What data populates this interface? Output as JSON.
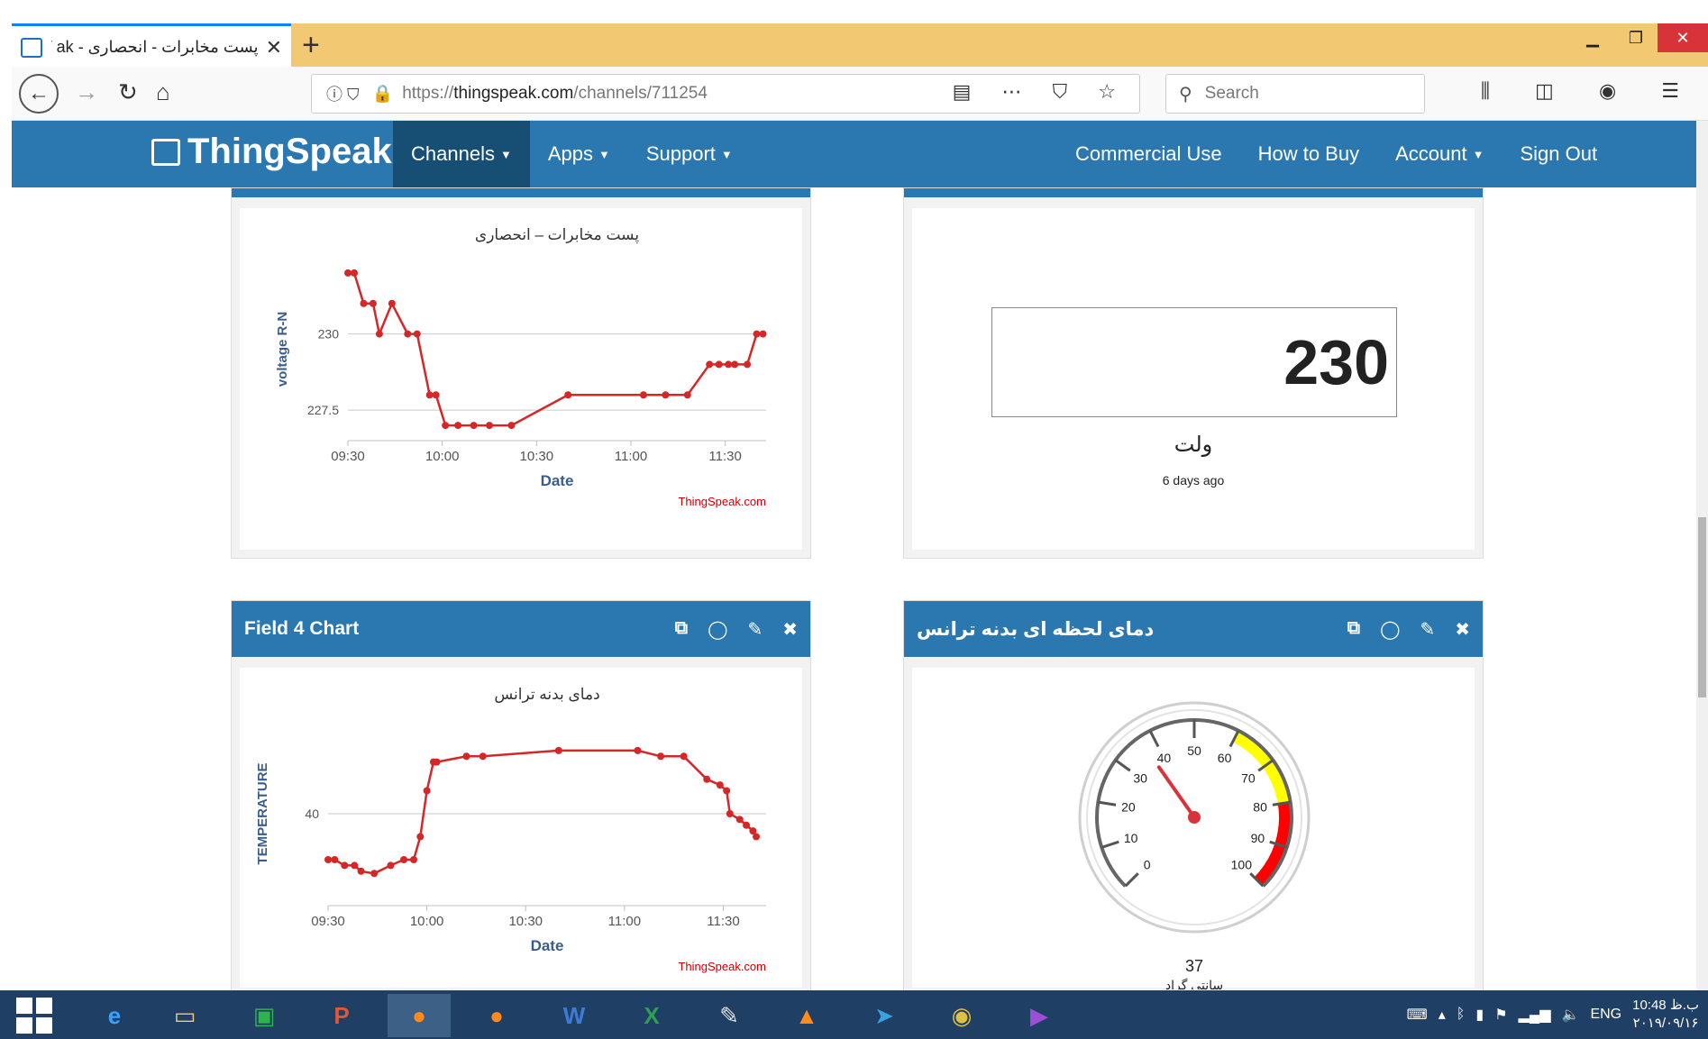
{
  "browser": {
    "tab_title": "پست مخابرات - انحصاری - IoT ak",
    "tab_close": "✕",
    "new_tab": "+",
    "url_prefix": "https://",
    "url_domain": "thingspeak.com",
    "url_path": "/channels/711254",
    "search_placeholder": "Search"
  },
  "header": {
    "logo_text": "ThingSpeak",
    "logo_tm": "™",
    "nav_left": [
      "Channels",
      "Apps",
      "Support"
    ],
    "nav_right": [
      "Commercial Use",
      "How to Buy",
      "Account",
      "Sign Out"
    ]
  },
  "panels": {
    "voltage_chart": {
      "watermark": "ThingSpeak.com"
    },
    "numeric_display": {
      "value": "230",
      "unit_label": "ولت",
      "timestamp": "6 days ago"
    },
    "field4_chart": {
      "header_title": "Field 4 Chart",
      "watermark": "ThingSpeak.com"
    },
    "gauge": {
      "header_title": "دمای لحظه ای بدنه ترانس",
      "value": "37",
      "unit": "سانتی گراد",
      "ticks": [
        "0",
        "10",
        "20",
        "30",
        "40",
        "50",
        "60",
        "70",
        "80",
        "90",
        "100"
      ],
      "colors": {
        "yellow": "#ffff00",
        "red": "#ff0000"
      }
    }
  },
  "taskbar": {
    "lang": "ENG",
    "time": "10:48 ب.ظ",
    "date": "۲۰۱۹/۰۹/۱۶"
  },
  "chart_data": [
    {
      "type": "line",
      "title": "پست مخابرات – انحصاری",
      "xlabel": "Date",
      "ylabel": "voltage R-N",
      "x_ticks": [
        "09:30",
        "10:00",
        "10:30",
        "11:00",
        "11:30"
      ],
      "y_ticks": [
        227.5,
        230
      ],
      "ylim": [
        226.5,
        232.5
      ],
      "color": "#d62728",
      "series": [
        {
          "x": [
            "09:30",
            "09:32",
            "09:35",
            "09:38",
            "09:40",
            "09:44",
            "09:49",
            "09:52",
            "09:56",
            "09:58",
            "10:01",
            "10:05",
            "10:10",
            "10:15",
            "10:22",
            "10:40",
            "11:04",
            "11:11",
            "11:18",
            "11:25",
            "11:28",
            "11:31",
            "11:33",
            "11:37",
            "11:40",
            "11:42"
          ],
          "y": [
            232,
            232,
            231,
            231,
            230,
            231,
            230,
            230,
            228,
            228,
            227,
            227,
            227,
            227,
            227,
            228,
            228,
            228,
            228,
            229,
            229,
            229,
            229,
            229,
            230,
            230
          ]
        }
      ]
    },
    {
      "type": "line",
      "title": "دمای بدنه ترانس",
      "xlabel": "Date",
      "ylabel": "TEMPERATURE",
      "x_ticks": [
        "09:30",
        "10:00",
        "10:30",
        "11:00",
        "11:30"
      ],
      "y_ticks": [
        40
      ],
      "ylim": [
        32,
        48
      ],
      "color": "#d62728",
      "series": [
        {
          "x": [
            "09:30",
            "09:32",
            "09:35",
            "09:38",
            "09:40",
            "09:44",
            "09:49",
            "09:53",
            "09:56",
            "09:58",
            "10:00",
            "10:02",
            "10:03",
            "10:12",
            "10:17",
            "10:40",
            "11:04",
            "11:11",
            "11:18",
            "11:25",
            "11:29",
            "11:31",
            "11:32",
            "11:35",
            "11:37",
            "11:39",
            "11:40"
          ],
          "y": [
            36,
            36,
            35.5,
            35.5,
            35,
            34.8,
            35.5,
            36,
            36,
            38,
            42,
            44.5,
            44.5,
            45,
            45,
            45.5,
            45.5,
            45,
            45,
            43,
            42.5,
            42,
            40,
            39.5,
            39,
            38.5,
            38
          ]
        }
      ]
    }
  ]
}
